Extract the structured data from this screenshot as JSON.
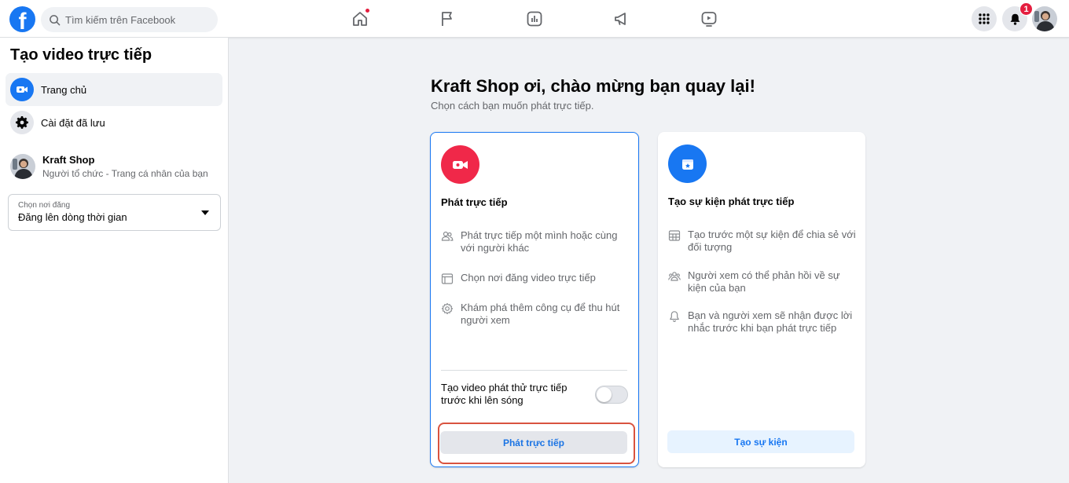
{
  "header": {
    "logo_letter": "f",
    "search_placeholder": "Tìm kiếm trên Facebook",
    "nav_icons": [
      "home-icon",
      "flag-icon",
      "insights-icon",
      "megaphone-icon",
      "video-icon"
    ],
    "notification_count": "1"
  },
  "sidebar": {
    "title": "Tạo video trực tiếp",
    "items": [
      {
        "label": "Trang chủ",
        "icon": "live-video-icon",
        "active": true
      },
      {
        "label": "Cài đặt đã lưu",
        "icon": "gear-icon",
        "active": false
      }
    ],
    "organizer": {
      "name": "Kraft Shop",
      "subtitle": "Người tổ chức - Trang cá nhân của bạn"
    },
    "post_location": {
      "label": "Chọn nơi đăng",
      "value": "Đăng lên dòng thời gian"
    }
  },
  "main": {
    "title": "Kraft Shop ơi, chào mừng bạn quay lại!",
    "subtitle": "Chọn cách bạn muốn phát trực tiếp.",
    "cards": [
      {
        "title": "Phát trực tiếp",
        "icon": "live-camera-icon",
        "features": [
          {
            "icon": "people-icon",
            "text": "Phát trực tiếp một mình hoặc cùng với người khác"
          },
          {
            "icon": "browser-icon",
            "text": "Chọn nơi đăng video trực tiếp"
          },
          {
            "icon": "gear-icon",
            "text": "Khám phá thêm công cụ để thu hút người xem"
          }
        ],
        "toggle_label": "Tạo video phát thử trực tiếp trước khi lên sóng",
        "toggle_on": false,
        "button": "Phát trực tiếp"
      },
      {
        "title": "Tạo sự kiện phát trực tiếp",
        "icon": "event-calendar-icon",
        "features": [
          {
            "icon": "calendar-grid-icon",
            "text": "Tạo trước một sự kiện để chia sẻ với đối tượng"
          },
          {
            "icon": "people-icon",
            "text": "Người xem có thể phản hồi về sự kiện của bạn"
          },
          {
            "icon": "bell-icon",
            "text": "Bạn và người xem sẽ nhận được lời nhắc trước khi bạn phát trực tiếp"
          }
        ],
        "button": "Tạo sự kiện"
      }
    ]
  },
  "colors": {
    "brand": "#1877f2",
    "live_red": "#f02849",
    "highlight": "#d9533f",
    "background": "#f0f2f5"
  }
}
